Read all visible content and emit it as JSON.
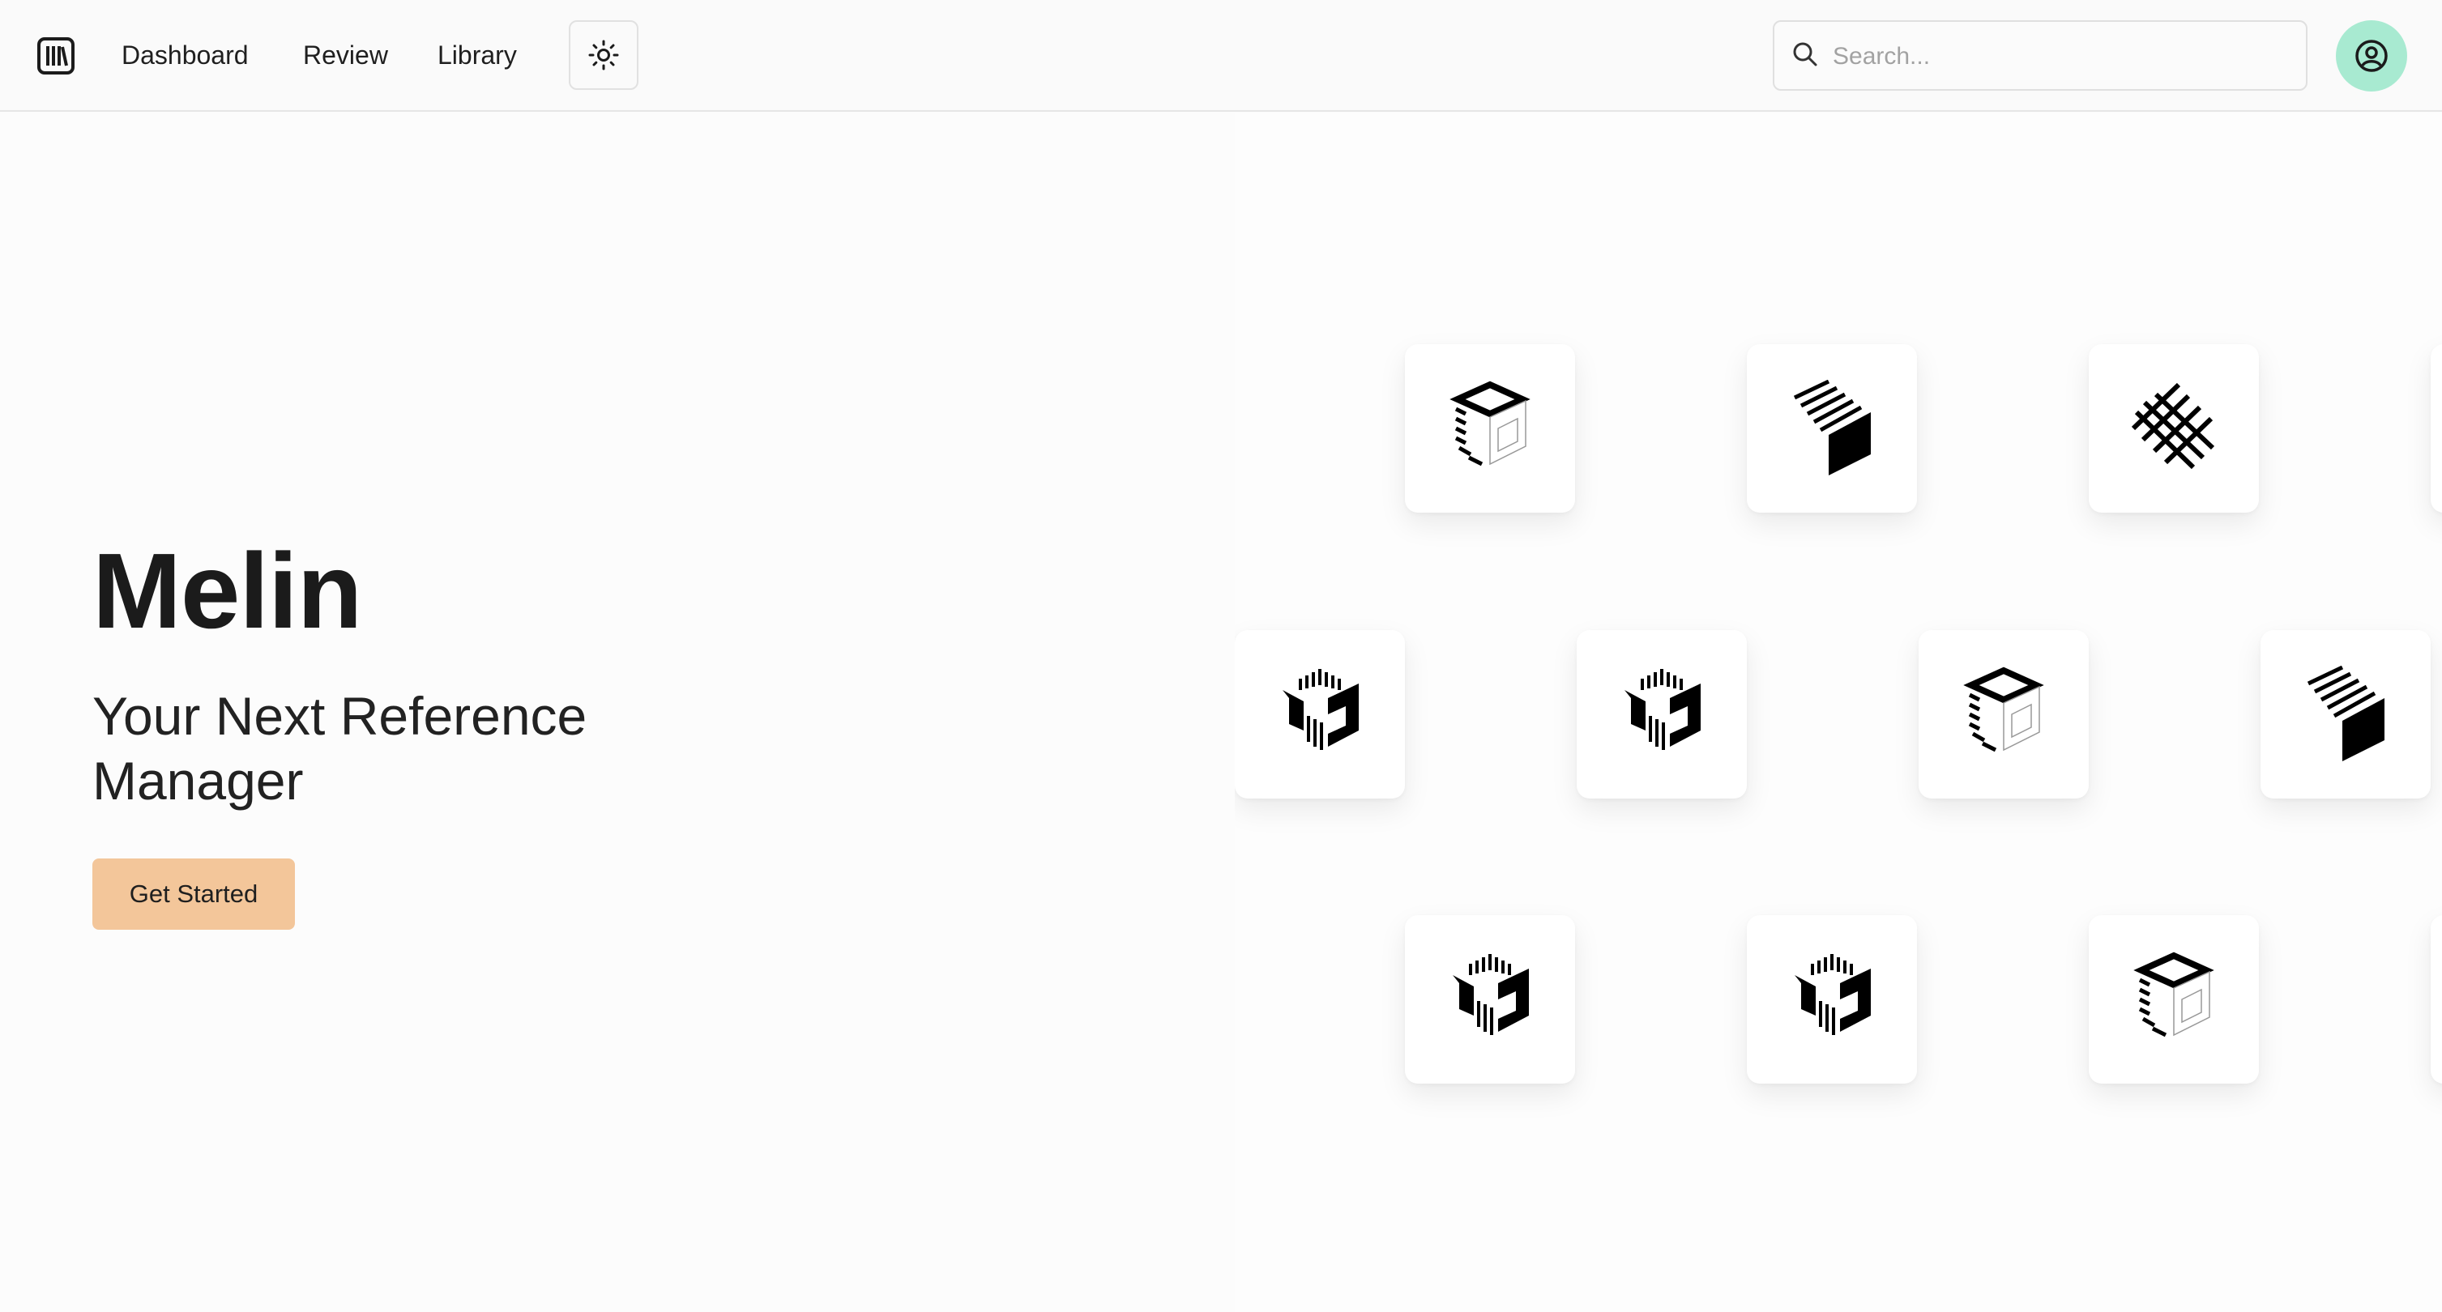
{
  "nav": {
    "links": [
      "Dashboard",
      "Review",
      "Library"
    ],
    "theme_icon": "sun-icon",
    "logo_icon": "library-books-icon"
  },
  "search": {
    "placeholder": "Search...",
    "value": "",
    "icon": "search-icon"
  },
  "avatar": {
    "icon": "user-circle-icon",
    "color": "#a8ead1"
  },
  "hero": {
    "title": "Melin",
    "subtitle": "Your Next Reference Manager",
    "cta_label": "Get Started",
    "cta_color": "#f3c69a"
  },
  "tiles": {
    "rows": [
      [
        "open-cube-icon",
        "striped-block-icon",
        "hatched-cross-icon",
        ""
      ],
      [
        "hex-box-icon",
        "hex-box-icon",
        "open-cube-icon",
        "striped-block-icon"
      ],
      [
        "hex-box-icon",
        "hex-box-icon",
        "open-cube-icon",
        ""
      ]
    ]
  }
}
